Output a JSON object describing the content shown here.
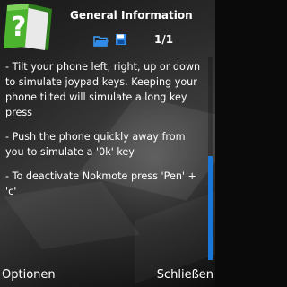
{
  "header": {
    "title": "General Information",
    "page_indicator": "1/1",
    "app_icon": "help-book-icon",
    "status_icons": [
      "folder-icon",
      "save-icon"
    ]
  },
  "content": {
    "paragraphs": [
      "- Tilt your phone left, right, up or down to simulate joypad keys. Keeping your phone tilted will simulate a long key press",
      "- Push the phone quickly away from you to simulate a '0k' key",
      "- To deactivate Nokmote press 'Pen' + 'c'"
    ]
  },
  "scrollbar": {
    "position_fraction": 0.5,
    "visible_fraction": 0.5
  },
  "softkeys": {
    "left": "Optionen",
    "right": "Schließen"
  },
  "colors": {
    "accent": "#1877d8",
    "icon_green": "#3aa32a",
    "text": "#ffffff"
  }
}
